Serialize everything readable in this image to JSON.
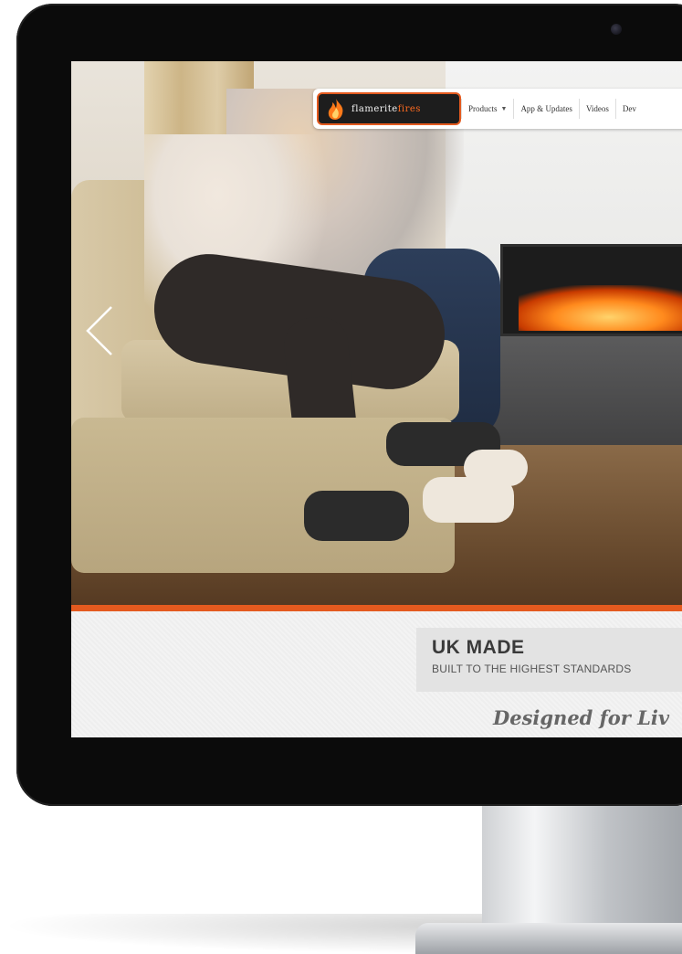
{
  "brand": {
    "logo_text_plain": "flamerite",
    "logo_text_highlight": "fires",
    "accent_color": "#e45a1f"
  },
  "nav": {
    "items": [
      {
        "label": "Products",
        "has_dropdown": true
      },
      {
        "label": "App & Updates"
      },
      {
        "label": "Videos"
      },
      {
        "label": "Dev"
      }
    ]
  },
  "hero": {
    "prev_arrow_icon": "chevron-left-icon"
  },
  "feature": {
    "title": "UK MADE",
    "subtitle": "BUILT TO THE HIGHEST STANDARDS"
  },
  "tagline": "Designed for Liv"
}
